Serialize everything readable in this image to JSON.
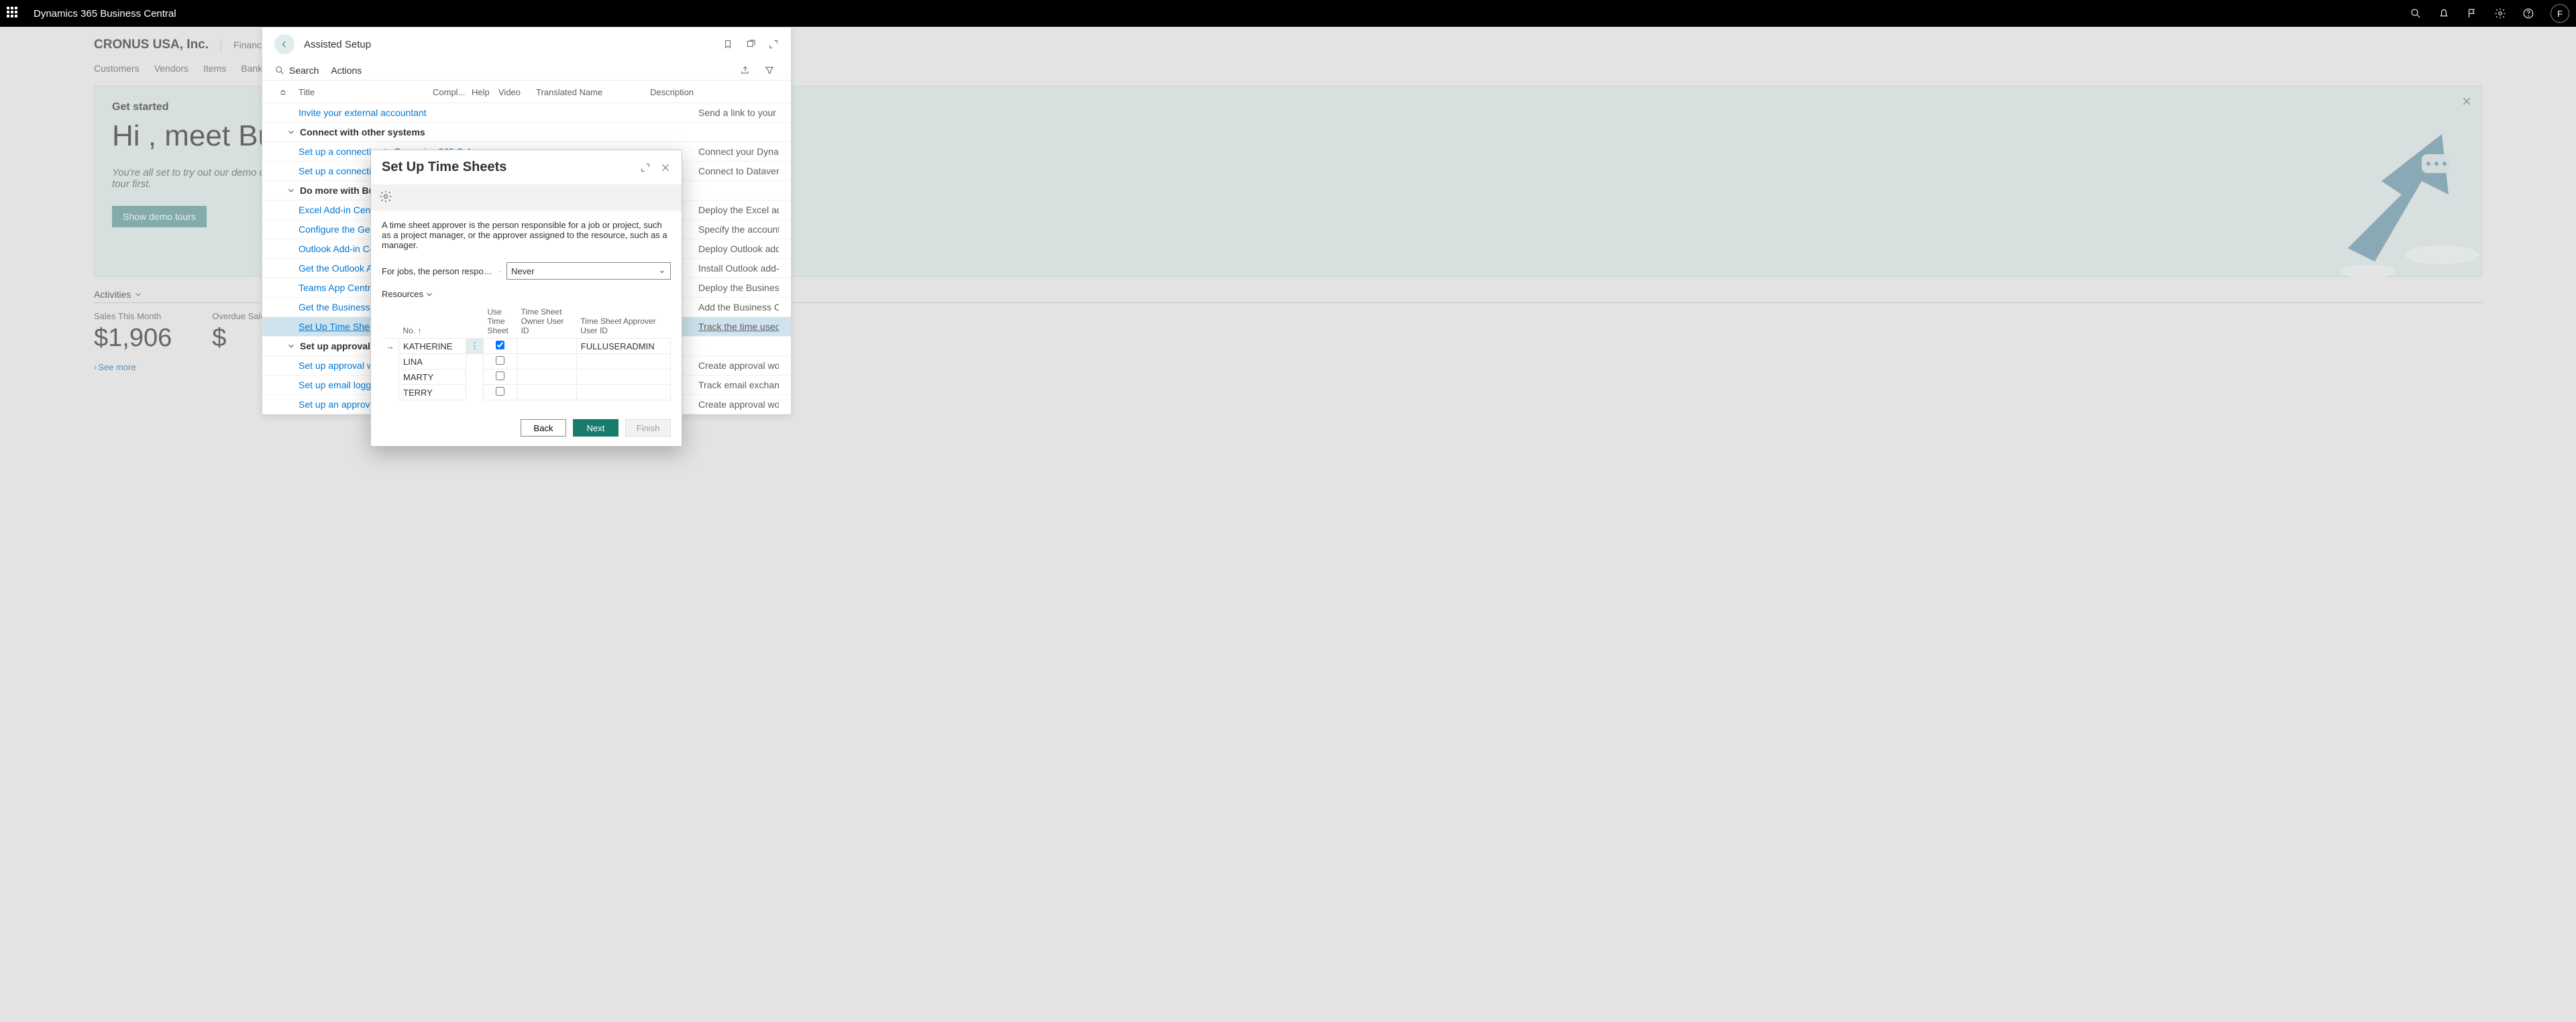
{
  "topbar": {
    "title": "Dynamics 365 Business Central",
    "avatar": "F"
  },
  "page": {
    "company": "CRONUS USA, Inc.",
    "finance": "Finance",
    "nav": [
      "Customers",
      "Vendors",
      "Items",
      "Bank A"
    ],
    "banner": {
      "get_started": "Get started",
      "headline": "Hi , meet Business Central!",
      "sub": "You're all set to try out our demo company, set up your own, or take a quick tour first.",
      "demo_btn": "Show demo tours"
    },
    "activities": {
      "label": "Activities"
    },
    "metrics": [
      {
        "label": "Sales This Month",
        "value": "$1,906"
      },
      {
        "label": "Overdue Sales Amount",
        "value": "$"
      }
    ],
    "see_more": "See more"
  },
  "panel": {
    "title": "Assisted Setup",
    "search": "Search",
    "actions": "Actions",
    "cols": {
      "title": "Title",
      "compl": "Compl...",
      "help": "Help",
      "video": "Video",
      "trans": "Translated Name",
      "desc": "Description"
    },
    "rows": [
      {
        "type": "link",
        "t": "Invite your external accountant",
        "d": "Send a link to your exte"
      },
      {
        "type": "group",
        "t": "Connect with other systems",
        "d": ""
      },
      {
        "type": "link",
        "t": "Set up a connection to Dynamics 365 Sales",
        "d": "Connect your Dynamic"
      },
      {
        "type": "link",
        "t": "Set up a connection to Dataverse",
        "d": "Connect to Dataverse f"
      },
      {
        "type": "group",
        "t": "Do more with Business Central",
        "d": ""
      },
      {
        "type": "link",
        "t": "Excel Add-in Centralized Deployment",
        "d": "Deploy the Excel add-in"
      },
      {
        "type": "link",
        "t": "Configure the General Ledger Setup",
        "d": "Specify the accounts to"
      },
      {
        "type": "link",
        "t": "Outlook Add-in Centralized Deployment",
        "d": "Deploy Outlook add-in"
      },
      {
        "type": "link",
        "t": "Get the Outlook Add-in",
        "d": "Install Outlook add-in t"
      },
      {
        "type": "link",
        "t": "Teams App Centralized Deployment",
        "d": "Deploy the Business Ce"
      },
      {
        "type": "link",
        "t": "Get the Business Central app for Teams",
        "d": "Add the Business Centra"
      },
      {
        "type": "sel",
        "t": "Set Up Time Sheets",
        "d": "Track the time used on"
      },
      {
        "type": "group",
        "t": "Set up approval workflows",
        "d": ""
      },
      {
        "type": "link",
        "t": "Set up approval workflows",
        "d": "Create approval workflo"
      },
      {
        "type": "link",
        "t": "Set up email logging",
        "d": "Track email exchanges"
      },
      {
        "type": "link",
        "t": "Set up an approval workflow for a customer",
        "d": "Create approval workflo"
      }
    ]
  },
  "dialog": {
    "title": "Set Up Time Sheets",
    "desc": "A time sheet approver is the person responsible for a job or project, such as a project manager, or the approver assigned to the resource, such as a manager.",
    "field_label": "For jobs, the person responsibl…",
    "field_value": "Never",
    "resources_label": "Resources",
    "cols": {
      "no": "No. ↑",
      "use": "Use Time Sheet",
      "owner": "Time Sheet Owner User ID",
      "approver": "Time Sheet Approver User ID"
    },
    "rows": [
      {
        "no": "KATHERINE",
        "use": true,
        "owner": "",
        "approver": "FULLUSERADMIN",
        "sel": true
      },
      {
        "no": "LINA",
        "use": false,
        "owner": "",
        "approver": ""
      },
      {
        "no": "MARTY",
        "use": false,
        "owner": "",
        "approver": ""
      },
      {
        "no": "TERRY",
        "use": false,
        "owner": "",
        "approver": ""
      }
    ],
    "btn_back": "Back",
    "btn_next": "Next",
    "btn_finish": "Finish"
  }
}
